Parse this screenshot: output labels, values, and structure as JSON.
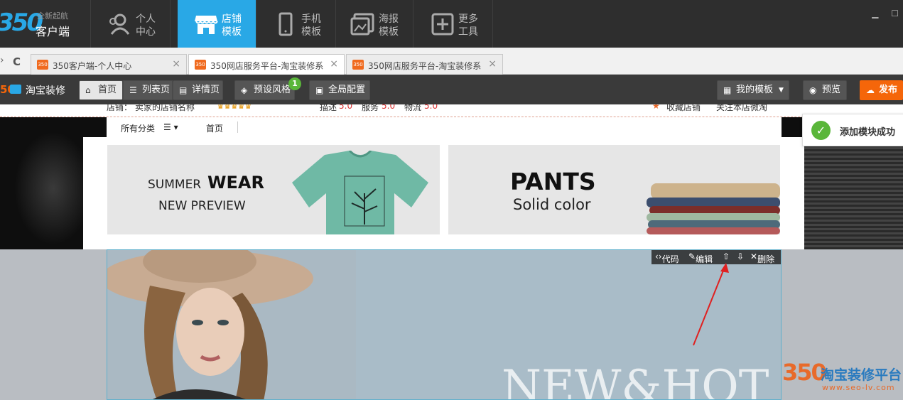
{
  "app": {
    "logo_big": "350",
    "logo_small": "全新起航",
    "logo_main": "客户端"
  },
  "nav": [
    {
      "line1": "个人",
      "line2": "中心",
      "icon": "user-icon"
    },
    {
      "line1": "店铺",
      "line2": "模板",
      "icon": "store-icon"
    },
    {
      "line1": "手机",
      "line2": "模板",
      "icon": "phone-icon"
    },
    {
      "line1": "海报",
      "line2": "模板",
      "icon": "poster-icon"
    },
    {
      "line1": "更多",
      "line2": "工具",
      "icon": "plus-icon"
    }
  ],
  "window": {
    "minimize": "▁",
    "maximize": "☐"
  },
  "tabs": [
    {
      "favicon": "350",
      "title": "350客户端-个人中心"
    },
    {
      "favicon": "350",
      "title": "350网店服务平台-淘宝装修系"
    },
    {
      "favicon": "350",
      "title": "350网店服务平台-淘宝装修系"
    }
  ],
  "browser": {
    "back": "›",
    "refresh": "C",
    "close": "×"
  },
  "toolbar": {
    "brand_prefix": "50",
    "brand": "淘宝装修",
    "home": "首页",
    "list": "列表页",
    "detail": "详情页",
    "preset": "预设风格",
    "preset_badge": "1",
    "global": "全局配置",
    "my_templates": "我的模板",
    "preview": "预览",
    "publish": "发布"
  },
  "store": {
    "shop_label": "店铺：",
    "shop_name": "卖家的店铺名称",
    "desc_label": "描述",
    "desc_score": "5.0",
    "service_label": "服务",
    "service_score": "5.0",
    "logistics_label": "物流",
    "logistics_score": "5.0",
    "favorite": "收藏店铺",
    "follow": "关注本店微淘"
  },
  "catnav": {
    "all": "所有分类",
    "home": "首页"
  },
  "promo": {
    "left_summer": "SUMMER",
    "left_wear": "WEAR",
    "left_sub": "NEW PREVIEW",
    "right_title": "PANTS",
    "right_sub": "Solid color"
  },
  "toast": {
    "message": "添加模块成功"
  },
  "module_tools": {
    "code": "代码",
    "edit": "编辑",
    "delete": "删除"
  },
  "banner": {
    "headline": "NEW&HOT"
  },
  "watermark": {
    "brand": "350",
    "text": "淘宝装修平台",
    "url": "www.seo-lv.com"
  },
  "colors": {
    "accent": "#29a8e6",
    "publish": "#f5660a",
    "success": "#5ab63a"
  }
}
